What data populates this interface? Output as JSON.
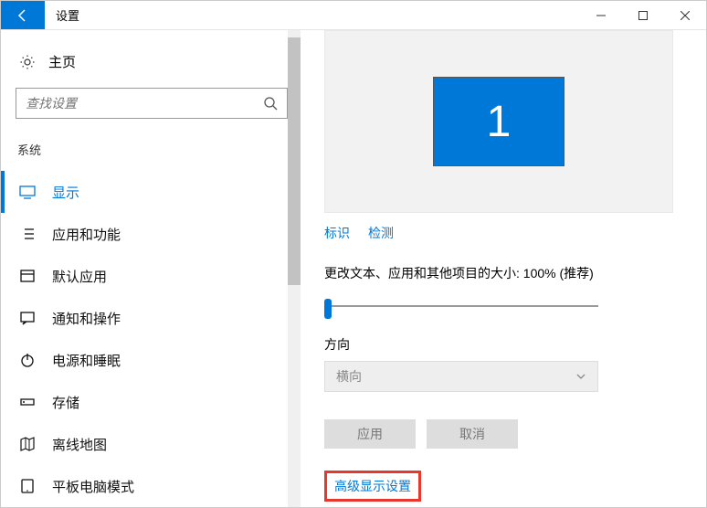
{
  "titlebar": {
    "title": "设置"
  },
  "sidebar": {
    "home": "主页",
    "search_placeholder": "查找设置",
    "category": "系统",
    "items": [
      {
        "label": "显示"
      },
      {
        "label": "应用和功能"
      },
      {
        "label": "默认应用"
      },
      {
        "label": "通知和操作"
      },
      {
        "label": "电源和睡眠"
      },
      {
        "label": "存储"
      },
      {
        "label": "离线地图"
      },
      {
        "label": "平板电脑模式"
      }
    ]
  },
  "main": {
    "monitor_number": "1",
    "identify": "标识",
    "detect": "检测",
    "scale_label": "更改文本、应用和其他项目的大小: 100% (推荐)",
    "orientation_label": "方向",
    "orientation_value": "横向",
    "apply": "应用",
    "cancel": "取消",
    "advanced": "高级显示设置"
  }
}
